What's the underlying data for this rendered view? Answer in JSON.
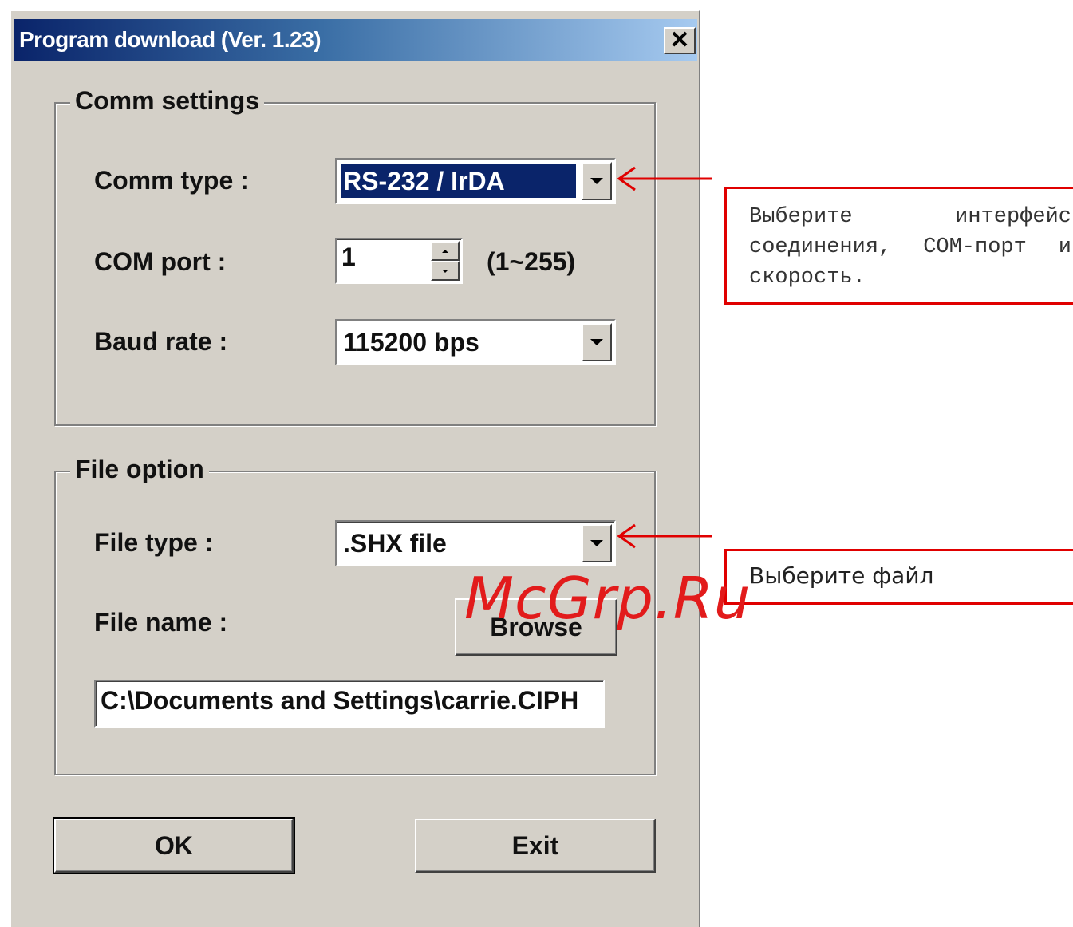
{
  "window": {
    "title": "Program download  (Ver. 1.23)",
    "close_glyph": "✕"
  },
  "comm_settings": {
    "legend": "Comm settings",
    "comm_type_label": "Comm type :",
    "comm_type_value": "RS-232 / IrDA",
    "com_port_label": "COM port :",
    "com_port_value": "1",
    "com_port_range": "(1~255)",
    "baud_rate_label": "Baud rate :",
    "baud_rate_value": "115200 bps"
  },
  "file_option": {
    "legend": "File option",
    "file_type_label": "File type :",
    "file_type_value": ".SHX file",
    "file_name_label": "File name :",
    "browse_label": "Browse",
    "file_path_value": "C:\\Documents and Settings\\carrie.CIPH"
  },
  "buttons": {
    "ok_label": "OK",
    "exit_label": "Exit"
  },
  "annotations": {
    "callout_comm": "Выберите интерфейс соединения, COM-порт и скорость.",
    "callout_file": "Выберите файл",
    "arrow_color": "#e00000"
  },
  "watermark": "McGrp.Ru",
  "colors": {
    "dialog_bg": "#d4d0c8",
    "title_start": "#0a246a",
    "title_end": "#a6caf0",
    "selection_bg": "#0a246a"
  }
}
